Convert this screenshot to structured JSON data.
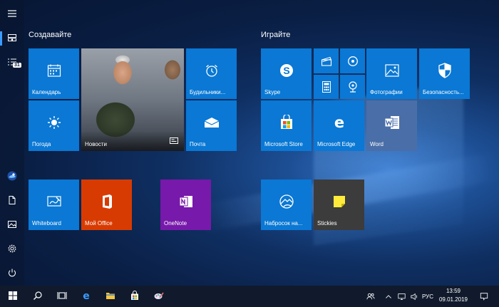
{
  "start": {
    "groups": [
      {
        "title": "Создавайте"
      },
      {
        "title": "Играйте"
      }
    ],
    "tiles": {
      "calendar": {
        "label": "Календарь"
      },
      "news": {
        "label": "Новости"
      },
      "alarms": {
        "label": "Будильники..."
      },
      "weather": {
        "label": "Погода"
      },
      "mail": {
        "label": "Почта"
      },
      "whiteboard": {
        "label": "Whiteboard"
      },
      "my_office": {
        "label": "Мой Office"
      },
      "onenote": {
        "label": "OneNote"
      },
      "skype": {
        "label": "Skype"
      },
      "photos": {
        "label": "Фотографии"
      },
      "security": {
        "label": "Безопасность..."
      },
      "store": {
        "label": "Microsoft Store"
      },
      "edge": {
        "label": "Microsoft Edge"
      },
      "word": {
        "label": "Word"
      },
      "sketch": {
        "label": "Набросок на..."
      },
      "stickies": {
        "label": "Stickies"
      }
    }
  },
  "rail": {
    "calendar_badge": "31"
  },
  "taskbar": {
    "language": "РУС",
    "time": "13:59",
    "date": "09.01.2019"
  },
  "colors": {
    "tile_blue": "#0a78d4",
    "office_orange": "#d83b01",
    "onenote_purple": "#7719aa",
    "stickies_gray": "#3c3c3c",
    "word_gray": "#4a6ea8",
    "taskbar": "#101a2c"
  },
  "icons": [
    "hamburger-icon",
    "tiles-icon",
    "list-icon",
    "avatar-icon",
    "document-icon",
    "pictures-icon",
    "settings-icon",
    "power-icon",
    "windows-icon",
    "search-icon",
    "task-view-icon",
    "edge-icon",
    "file-explorer-icon",
    "store-icon",
    "paint-icon",
    "people-icon",
    "chevron-up-icon",
    "network-icon",
    "volume-icon",
    "notification-icon"
  ]
}
